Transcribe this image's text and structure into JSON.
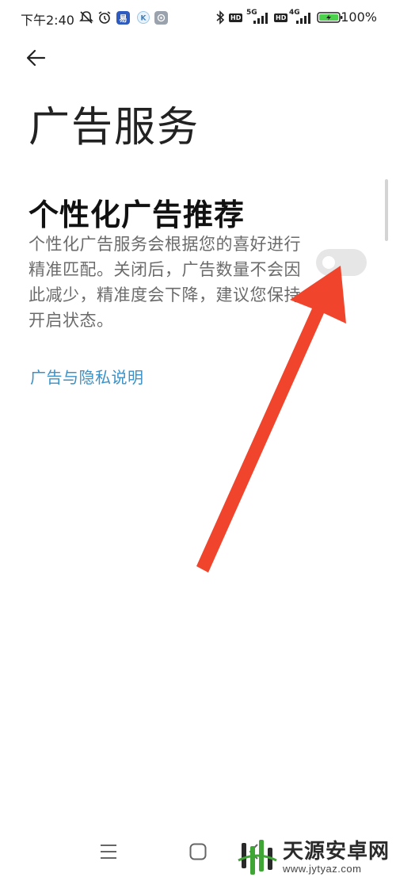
{
  "status_bar": {
    "time": "下午2:40",
    "signal_5g": "5G",
    "signal_4g": "4G",
    "hd_label": "HD",
    "battery": "100%",
    "icons": [
      "mute-bell-icon",
      "alarm-icon",
      "app-icon",
      "k-app-icon",
      "app-icon",
      "bluetooth-icon",
      "hd-icon",
      "signal-icon",
      "hd-icon",
      "signal-icon",
      "battery-charging-icon"
    ]
  },
  "header": {
    "back_icon": "back-arrow-icon",
    "title": "广告服务"
  },
  "setting": {
    "title": "个性化广告推荐",
    "description": "个性化广告服务会根据您的喜好进行精准匹配。关闭后，广告数量不会因此减少，精准度会下降，建议您保持开启状态。",
    "toggle_state": "off"
  },
  "links": {
    "privacy": "广告与隐私说明"
  },
  "annotation": {
    "arrow_color": "#f0452c",
    "points_to": "toggle"
  },
  "nav_bar": {
    "icons": [
      "menu-icon",
      "home-icon",
      "back-icon"
    ]
  },
  "watermark": {
    "name": "天源安卓网",
    "url": "www.jytyaz.com"
  },
  "colors": {
    "link": "#3b92c8",
    "toggle_off": "#e6e6e6",
    "battery_fill": "#4cd14c"
  }
}
